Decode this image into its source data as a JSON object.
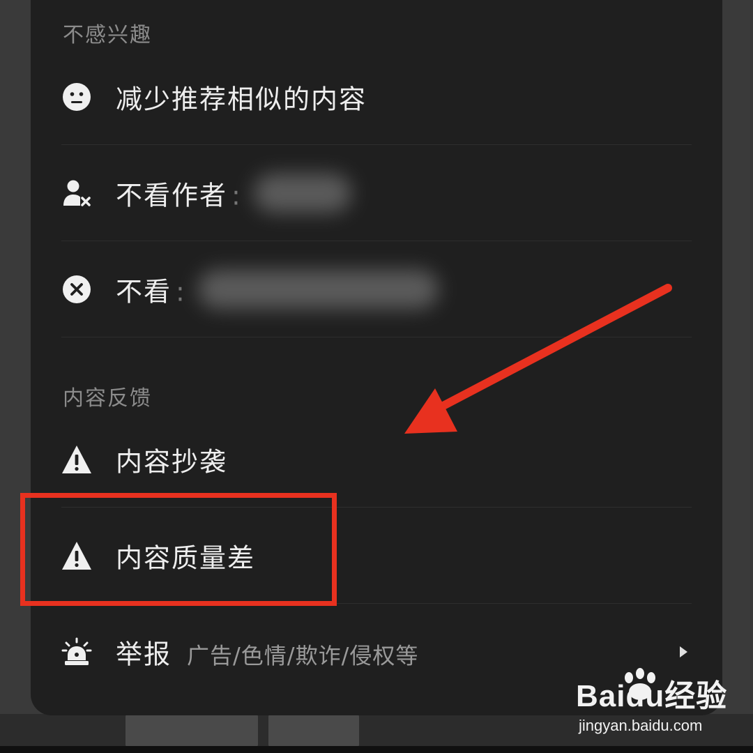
{
  "sections": {
    "not_interested": "不感兴趣",
    "feedback": "内容反馈"
  },
  "items": {
    "reduce_similar": "减少推荐相似的内容",
    "hide_author": "不看作者",
    "hide_author_colon": ":",
    "hide_topic": "不看",
    "hide_topic_colon": ":",
    "plagiarism": "内容抄袭",
    "low_quality": "内容质量差",
    "report": "举报",
    "report_sub": "广告/色情/欺诈/侵权等"
  },
  "icons": {
    "reduce_similar": "neutral-face-icon",
    "hide_author": "user-block-icon",
    "hide_topic": "close-circle-icon",
    "plagiarism": "warning-icon",
    "low_quality": "warning-icon",
    "report": "alarm-icon",
    "report_more": "chevron-right-icon"
  },
  "colors": {
    "sheet_bg": "#1f1f1f",
    "text": "#eeeeee",
    "section_text": "#8c8c8c",
    "annotation_red": "#e8311f"
  },
  "watermark": {
    "logo_text": "Baidu经验",
    "url": "jingyan.baidu.com"
  }
}
